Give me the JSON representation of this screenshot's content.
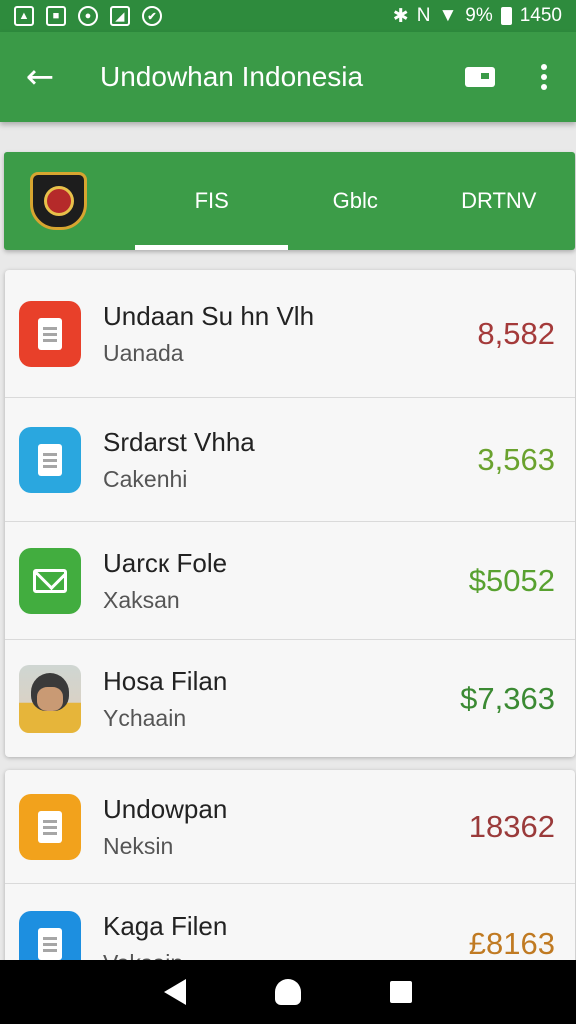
{
  "status_bar": {
    "left_icons": [
      "image-icon",
      "square-app-icon",
      "circle-app-icon",
      "photo-icon",
      "chat-icon"
    ],
    "bluetooth": "bluetooth-icon",
    "nfc": "nfc-icon",
    "wifi": "wifi-icon",
    "battery_text": "9%",
    "time": "1450"
  },
  "app_bar": {
    "title": "Undowhan  Indonesia",
    "colors": {
      "status": "#2e8b3d",
      "bar": "#3a9a47"
    }
  },
  "tabs": [
    {
      "label": "FIS",
      "active": true
    },
    {
      "label": "Gblc",
      "active": false
    },
    {
      "label": "DRTNV",
      "active": false
    }
  ],
  "list1": [
    {
      "title": "Undaan Su hn Vlh",
      "subtitle": "Uanada",
      "value": "8,582",
      "value_color": "#a43a3a",
      "icon": "document-icon",
      "icon_color": "#e8402a"
    },
    {
      "title": "Srdarst Vhha",
      "subtitle": "Cakenhi",
      "value": "3,563",
      "value_color": "#6aa22e",
      "icon": "notepad-icon",
      "icon_color": "#2aa7df"
    },
    {
      "title": "Uarcк Fole",
      "subtitle": "Xaksan",
      "value": "$5052",
      "value_color": "#58a130",
      "icon": "mail-icon",
      "icon_color": "#42ad3f"
    },
    {
      "title": "Hosa Filan",
      "subtitle": "Ychaain",
      "value": "$7,363",
      "value_color": "#3b8a33",
      "icon": "avatar-photo",
      "icon_color": ""
    }
  ],
  "list2": [
    {
      "title": "Undowpan",
      "subtitle": "Neksin",
      "value": "18362",
      "value_color": "#9a3a3a",
      "icon": "document-icon",
      "icon_color": "#f2a21c"
    },
    {
      "title": "Kaga Filen",
      "subtitle": "Vaksain",
      "value": "£8163",
      "value_color": "#c07a22",
      "icon": "document-icon",
      "icon_color": "#1d8fe0"
    }
  ]
}
